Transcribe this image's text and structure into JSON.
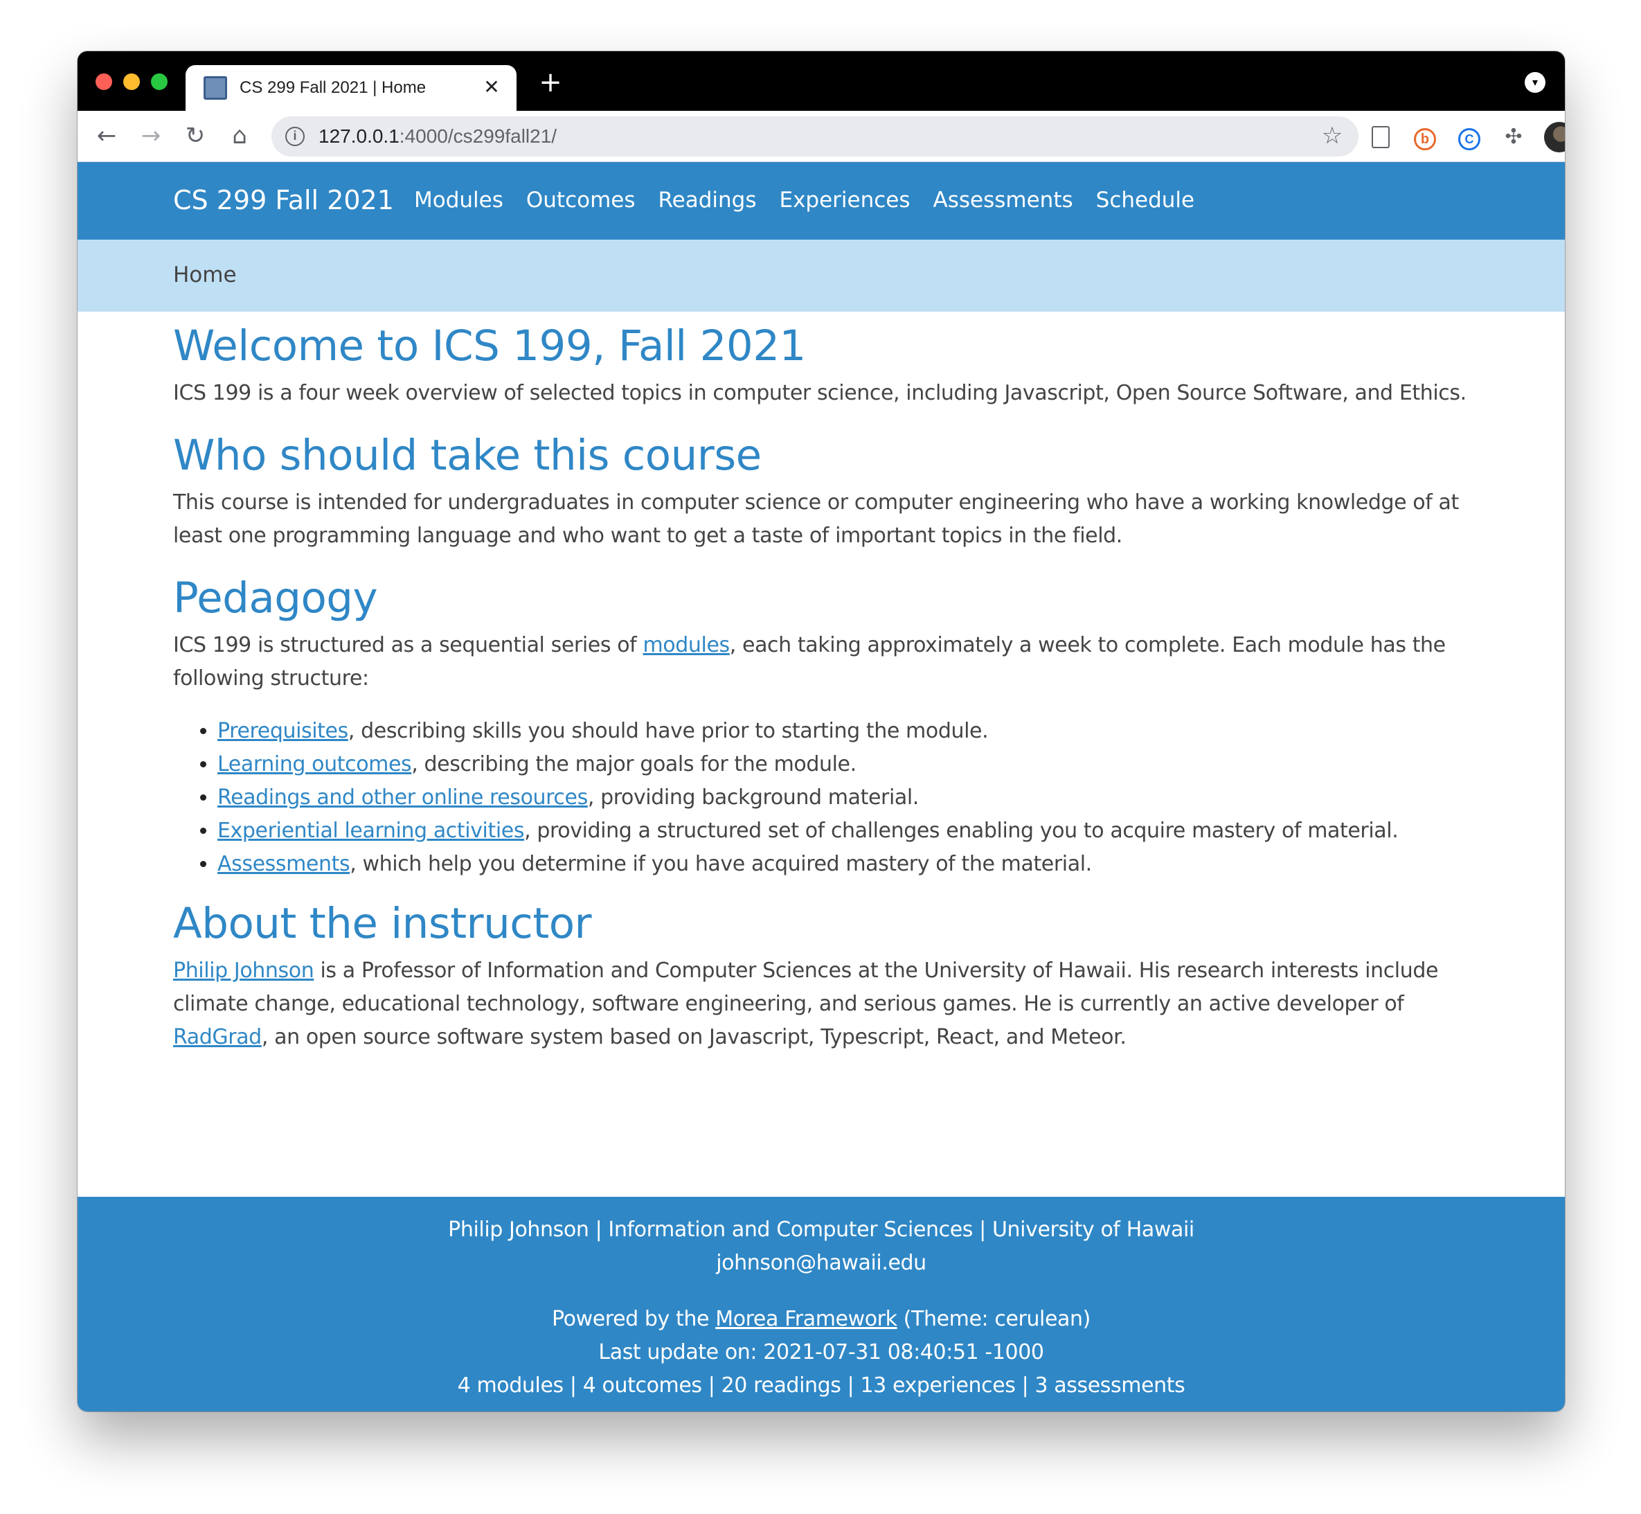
{
  "browser": {
    "tab_title": "CS 299 Fall 2021 | Home",
    "tab_close_glyph": "✕",
    "new_tab_glyph": "+",
    "url_host": "127.0.0.1",
    "url_path": ":4000/cs299fall21/",
    "icons": {
      "back": "back-arrow-icon",
      "forward": "forward-arrow-icon",
      "reload": "reload-icon",
      "home": "home-icon",
      "info": "site-info-icon",
      "bookmark": "star-icon",
      "extensions": "puzzle-icon",
      "menu": "kebab-menu-icon"
    }
  },
  "navbar": {
    "brand": "CS 299 Fall 2021",
    "links": [
      "Modules",
      "Outcomes",
      "Readings",
      "Experiences",
      "Assessments",
      "Schedule"
    ]
  },
  "breadcrumb": "Home",
  "sections": {
    "welcome": {
      "heading": "Welcome to ICS 199, Fall 2021",
      "text": "ICS 199 is a four week overview of selected topics in computer science, including Javascript, Open Source Software, and Ethics."
    },
    "who": {
      "heading": "Who should take this course",
      "text": "This course is intended for undergraduates in computer science or computer engineering who have a working knowledge of at least one programming language and who want to get a taste of important topics in the field."
    },
    "pedagogy": {
      "heading": "Pedagogy",
      "intro_before": "ICS 199 is structured as a sequential series of ",
      "intro_link": "modules",
      "intro_after": ", each taking approximately a week to complete. Each module has the following structure:",
      "items": [
        {
          "link": "Prerequisites",
          "text": ", describing skills you should have prior to starting the module."
        },
        {
          "link": "Learning outcomes",
          "text": ", describing the major goals for the module."
        },
        {
          "link": "Readings and other online resources",
          "text": ", providing background material."
        },
        {
          "link": "Experiential learning activities",
          "text": ", providing a structured set of challenges enabling you to acquire mastery of material."
        },
        {
          "link": "Assessments",
          "text": ", which help you determine if you have acquired mastery of the material."
        }
      ]
    },
    "instructor": {
      "heading": "About the instructor",
      "link1": "Philip Johnson",
      "text1": " is a Professor of Information and Computer Sciences at the University of Hawaii. His research interests include climate change, educational technology, software engineering, and serious games. He is currently an active developer of ",
      "link2": "RadGrad",
      "text2": ", an open source software system based on Javascript, Typescript, React, and Meteor."
    }
  },
  "footer": {
    "line1": "Philip Johnson | Information and Computer Sciences | University of Hawaii",
    "email": "johnson@hawaii.edu",
    "powered_before": "Powered by the ",
    "powered_link": "Morea Framework",
    "powered_after": " (Theme: cerulean)",
    "last_update": "Last update on: 2021-07-31 08:40:51 -1000",
    "stats": "4 modules | 4 outcomes | 20 readings | 13 experiences | 3 assessments"
  },
  "colors": {
    "primary": "#2f87c6",
    "breadcrumb_bg": "#bfdff5",
    "text": "#444444"
  }
}
